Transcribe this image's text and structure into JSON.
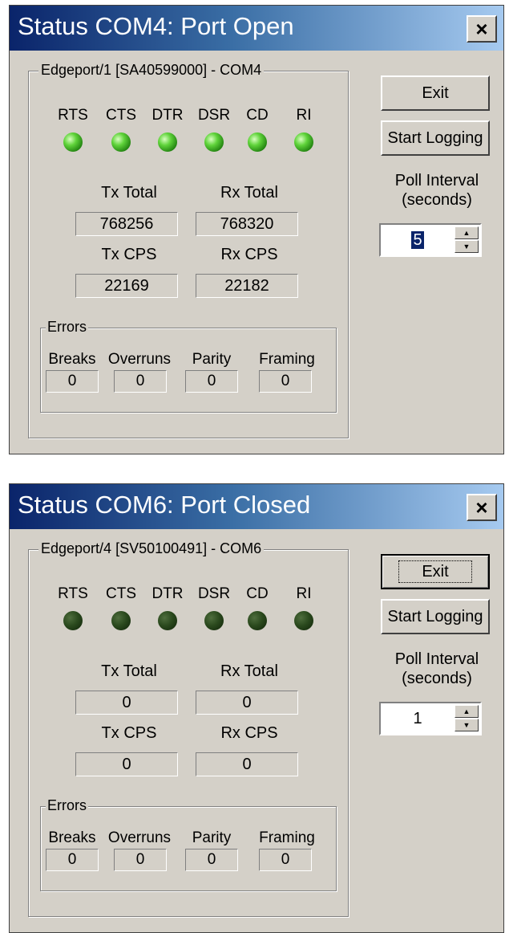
{
  "windows": [
    {
      "title": "Status COM4: Port Open",
      "close_label": "×",
      "group_label": "Edgeport/1 [SA40599000] - COM4",
      "signals": [
        {
          "label": "RTS",
          "state": "on"
        },
        {
          "label": "CTS",
          "state": "on"
        },
        {
          "label": "DTR",
          "state": "on"
        },
        {
          "label": "DSR",
          "state": "on"
        },
        {
          "label": "CD",
          "state": "on"
        },
        {
          "label": "RI",
          "state": "on"
        }
      ],
      "tx_total_label": "Tx Total",
      "rx_total_label": "Rx Total",
      "tx_total": "768256",
      "rx_total": "768320",
      "tx_cps_label": "Tx CPS",
      "rx_cps_label": "Rx CPS",
      "tx_cps": "22169",
      "rx_cps": "22182",
      "errors_label": "Errors",
      "errors": [
        {
          "label": "Breaks",
          "value": "0"
        },
        {
          "label": "Overruns",
          "value": "0"
        },
        {
          "label": "Parity",
          "value": "0"
        },
        {
          "label": "Framing",
          "value": "0"
        }
      ],
      "exit_label": "Exit",
      "logging_label": "Start Logging",
      "poll_label_1": "Poll Interval",
      "poll_label_2": "(seconds)",
      "poll_value": "5",
      "poll_selected": true,
      "exit_focused": false
    },
    {
      "title": "Status COM6: Port Closed",
      "close_label": "×",
      "group_label": "Edgeport/4 [SV50100491] - COM6",
      "signals": [
        {
          "label": "RTS",
          "state": "off"
        },
        {
          "label": "CTS",
          "state": "off"
        },
        {
          "label": "DTR",
          "state": "off"
        },
        {
          "label": "DSR",
          "state": "off"
        },
        {
          "label": "CD",
          "state": "off"
        },
        {
          "label": "RI",
          "state": "off"
        }
      ],
      "tx_total_label": "Tx Total",
      "rx_total_label": "Rx Total",
      "tx_total": "0",
      "rx_total": "0",
      "tx_cps_label": "Tx CPS",
      "rx_cps_label": "Rx CPS",
      "tx_cps": "0",
      "rx_cps": "0",
      "errors_label": "Errors",
      "errors": [
        {
          "label": "Breaks",
          "value": "0"
        },
        {
          "label": "Overruns",
          "value": "0"
        },
        {
          "label": "Parity",
          "value": "0"
        },
        {
          "label": "Framing",
          "value": "0"
        }
      ],
      "exit_label": "Exit",
      "logging_label": "Start Logging",
      "poll_label_1": "Poll Interval",
      "poll_label_2": "(seconds)",
      "poll_value": "1",
      "poll_selected": false,
      "exit_focused": true
    }
  ],
  "colors": {
    "dialog_bg": "#d4d0c8",
    "title_start": "#0a246a",
    "title_end": "#a6caf0",
    "led_on": "#5fd33a",
    "led_off": "#2b4a1e"
  }
}
